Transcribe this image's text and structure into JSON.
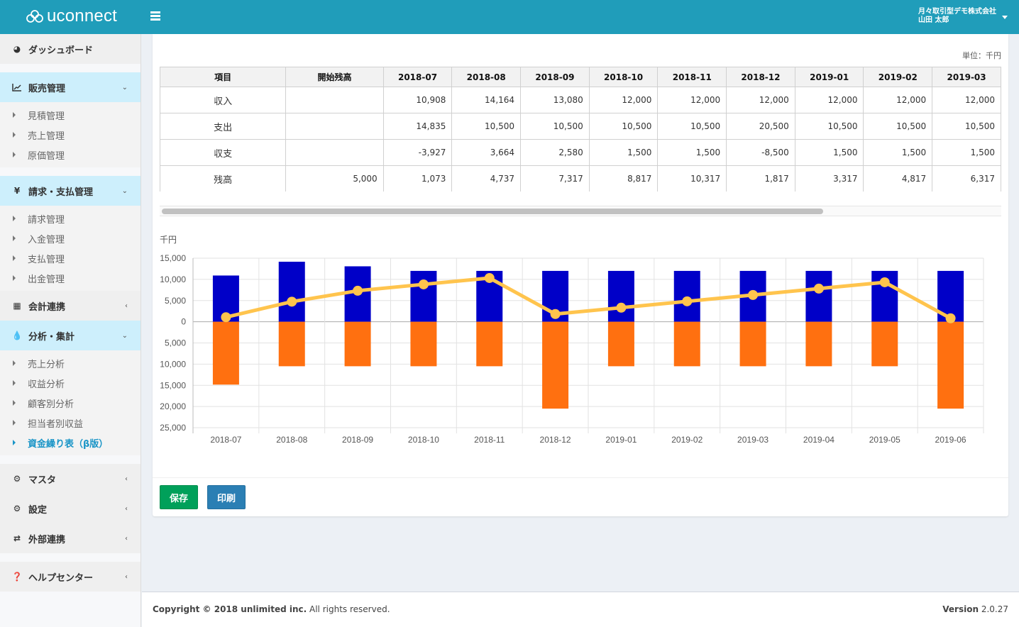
{
  "header": {
    "app_name": "uconnect",
    "company": "月々取引型デモ株式会社",
    "user": "山田 太郎"
  },
  "sidebar": {
    "dashboard": "ダッシュボード",
    "sales": {
      "label": "販売管理",
      "items": [
        "見積管理",
        "売上管理",
        "原価管理"
      ]
    },
    "billing": {
      "label": "請求・支払管理",
      "items": [
        "請求管理",
        "入金管理",
        "支払管理",
        "出金管理"
      ]
    },
    "accounting": "会計連携",
    "analysis": {
      "label": "分析・集計",
      "items": [
        "売上分析",
        "収益分析",
        "顧客別分析",
        "担当者別収益",
        "資金繰り表（β版）"
      ],
      "active_index": 4
    },
    "master": "マスタ",
    "settings": "設定",
    "external": "外部連携",
    "help": "ヘルプセンター"
  },
  "main": {
    "unit_label": "単位：千円",
    "table": {
      "headers": [
        "項目",
        "開始残高",
        "2018-07",
        "2018-08",
        "2018-09",
        "2018-10",
        "2018-11",
        "2018-12",
        "2019-01",
        "2019-02",
        "2019-03"
      ],
      "rows": [
        {
          "label": "収入",
          "opening": "",
          "values": [
            "10,908",
            "14,164",
            "13,080",
            "12,000",
            "12,000",
            "12,000",
            "12,000",
            "12,000",
            "12,000"
          ]
        },
        {
          "label": "支出",
          "opening": "",
          "values": [
            "14,835",
            "10,500",
            "10,500",
            "10,500",
            "10,500",
            "20,500",
            "10,500",
            "10,500",
            "10,500"
          ]
        },
        {
          "label": "収支",
          "opening": "",
          "values": [
            "-3,927",
            "3,664",
            "2,580",
            "1,500",
            "1,500",
            "-8,500",
            "1,500",
            "1,500",
            "1,500"
          ]
        },
        {
          "label": "残高",
          "opening": "5,000",
          "values": [
            "1,073",
            "4,737",
            "7,317",
            "8,817",
            "10,317",
            "1,817",
            "3,317",
            "4,817",
            "6,317"
          ]
        }
      ]
    },
    "buttons": {
      "save": "保存",
      "print": "印刷"
    }
  },
  "chart_data": {
    "type": "bar",
    "title": "",
    "ylabel": "千円",
    "xlabel": "",
    "categories": [
      "2018-07",
      "2018-08",
      "2018-09",
      "2018-10",
      "2018-11",
      "2018-12",
      "2019-01",
      "2019-02",
      "2019-03",
      "2019-04",
      "2019-05",
      "2019-06"
    ],
    "series": [
      {
        "name": "残高",
        "type": "line",
        "color": "#ffc44d",
        "values": [
          1073,
          4737,
          7317,
          8817,
          10317,
          1817,
          3317,
          4817,
          6317,
          7817,
          9317,
          817
        ]
      },
      {
        "name": "収入",
        "type": "bar",
        "color": "#0000c8",
        "values": [
          10908,
          14164,
          13080,
          12000,
          12000,
          12000,
          12000,
          12000,
          12000,
          12000,
          12000,
          12000
        ]
      },
      {
        "name": "支出",
        "type": "bar",
        "color": "#ff7010",
        "values": [
          -14835,
          -10500,
          -10500,
          -10500,
          -10500,
          -20500,
          -10500,
          -10500,
          -10500,
          -10500,
          -10500,
          -20500
        ]
      }
    ],
    "yticks": [
      15000,
      10000,
      5000,
      0,
      -5000,
      -10000,
      -15000,
      -20000,
      -25000
    ],
    "ytick_labels": [
      "15,000",
      "10,000",
      "5,000",
      "0",
      "5,000",
      "10,000",
      "15,000",
      "20,000",
      "25,000"
    ],
    "ylim": [
      -25000,
      15000
    ],
    "grid": true,
    "legend": "bottom-center"
  },
  "footer": {
    "copyright_bold": "Copyright © 2018 unlimited inc.",
    "copyright_rest": " All rights reserved.",
    "version_label": "Version",
    "version": " 2.0.27"
  }
}
